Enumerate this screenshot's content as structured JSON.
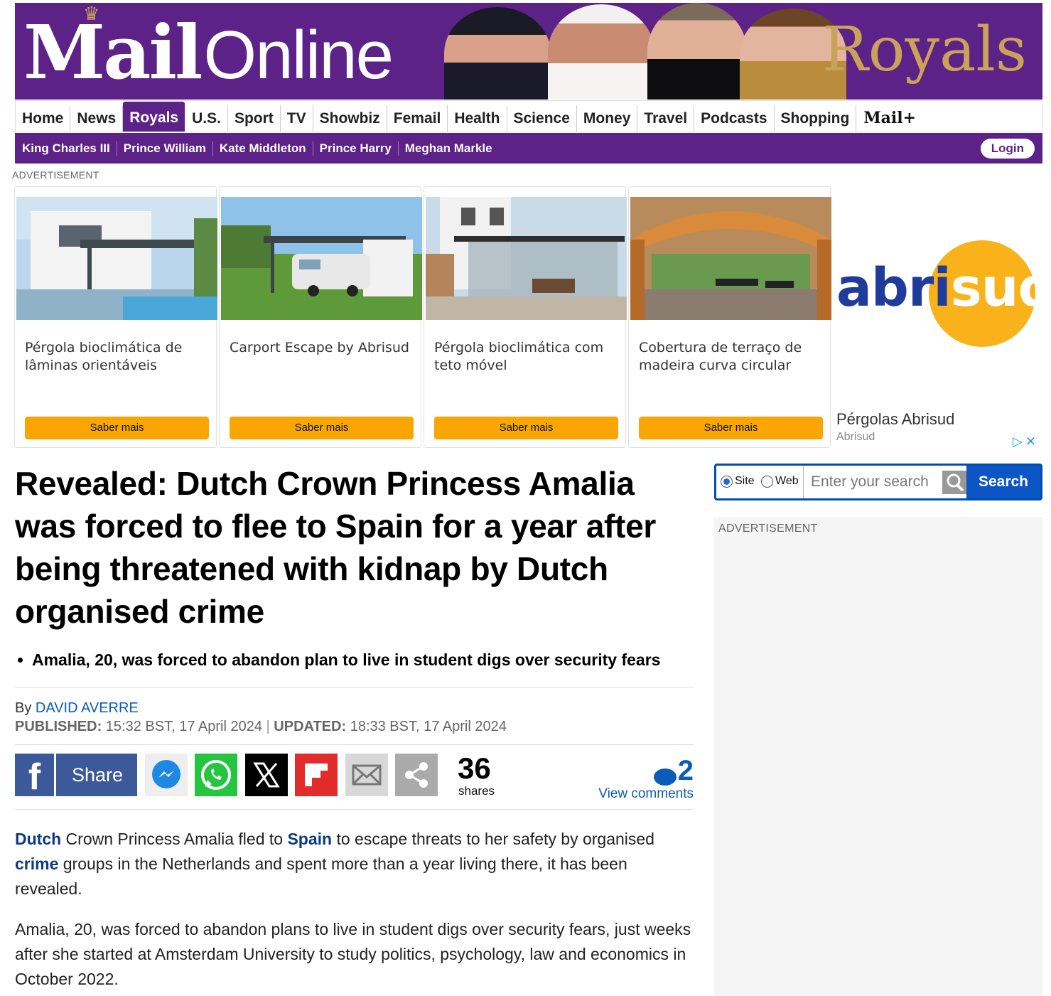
{
  "masthead": {
    "logo_mail": "Mail",
    "logo_online": "Online",
    "section_title": "Royals",
    "brand_color": "#5c2288",
    "gold_color": "#c9a35a"
  },
  "nav": {
    "items": [
      "Home",
      "News",
      "Royals",
      "U.S.",
      "Sport",
      "TV",
      "Showbiz",
      "Femail",
      "Health",
      "Science",
      "Money",
      "Travel",
      "Podcasts",
      "Shopping"
    ],
    "active": "Royals",
    "mail_plus": "Mail+"
  },
  "subnav": {
    "items": [
      "King Charles III",
      "Prince William",
      "Kate Middleton",
      "Prince Harry",
      "Meghan Markle"
    ],
    "login_label": "Login"
  },
  "ad": {
    "label": "ADVERTISEMENT",
    "cards": [
      {
        "title": "Pérgola bioclimática de lâminas orientáveis",
        "cta": "Saber mais"
      },
      {
        "title": "Carport Escape by Abrisud",
        "cta": "Saber mais"
      },
      {
        "title": "Pérgola bioclimática com teto móvel",
        "cta": "Saber mais"
      },
      {
        "title": "Cobertura de terraço de madeira curva circular",
        "cta": "Saber mais"
      }
    ],
    "logo_text_a": "abri",
    "logo_text_b": "sud",
    "side_title": "Pérgolas Abrisud",
    "side_sub": "Abrisud",
    "cta_color": "#f9a602"
  },
  "article": {
    "headline": "Revealed: Dutch Crown Princess Amalia was forced to flee to Spain for a year after being threatened with kidnap by Dutch organised crime",
    "bullets": [
      "Amalia, 20, was forced to abandon plan to live in student digs over security fears"
    ],
    "by_label": "By",
    "author": "DAVID AVERRE",
    "published_label": "PUBLISHED:",
    "published": "15:32 BST, 17 April 2024",
    "updated_label": "UPDATED:",
    "updated": "18:33 BST, 17 April 2024",
    "para1": {
      "link1": "Dutch",
      "text1": " Crown Princess Amalia fled to ",
      "link2": "Spain",
      "text2": " to escape threats to her safety by organised ",
      "link3": "crime",
      "text3": " groups in the Netherlands and spent more than a year living there, it has been revealed."
    },
    "para2": "Amalia, 20, was forced to abandon plans to live in student digs over security fears, just weeks after she started at Amsterdam University to study politics, psychology, law and economics in October 2022."
  },
  "share": {
    "facebook_label": "Share",
    "count": "36",
    "count_label": "shares",
    "comments_count": "2",
    "comments_label": "View comments",
    "icons": [
      "facebook-icon",
      "messenger-icon",
      "whatsapp-icon",
      "x-icon",
      "flipboard-icon",
      "email-icon",
      "share-icon"
    ]
  },
  "search": {
    "site_label": "Site",
    "web_label": "Web",
    "placeholder": "Enter your search",
    "button_label": "Search",
    "selected": "Site"
  },
  "side_ad": {
    "label": "ADVERTISEMENT"
  }
}
